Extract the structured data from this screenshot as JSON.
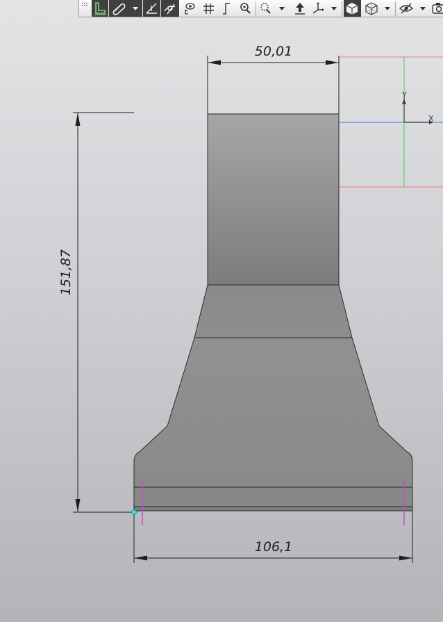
{
  "toolbar": {
    "buttons": [
      {
        "name": "grip-handle",
        "icon": "grip-icon"
      },
      {
        "name": "l-shape-part-button",
        "icon": "l-shape-part-icon",
        "active": true
      },
      {
        "name": "attach-button",
        "icon": "paperclip-icon",
        "active": true
      },
      {
        "name": "attach-dropdown",
        "icon": "chevron-down-icon",
        "active": true
      },
      {
        "name": "slope-button",
        "icon": "slope-icon",
        "active": true
      },
      {
        "name": "view-filter-button",
        "icon": "eye-filter-icon",
        "active": true
      },
      {
        "name": "point-visibility-button",
        "icon": "eye-point-icon"
      },
      {
        "name": "grid-button",
        "icon": "grid-icon"
      },
      {
        "name": "ortho-button",
        "icon": "ortho-step-icon"
      },
      {
        "name": "zoom-in-button",
        "icon": "magnifier-icon"
      },
      {
        "name": "zoom-window-button",
        "icon": "zoom-window-icon"
      },
      {
        "name": "zoom-dropdown",
        "icon": "chevron-down-icon"
      },
      {
        "name": "move-view-button",
        "icon": "move-arrow-icon"
      },
      {
        "name": "orientation-button",
        "icon": "axes-icon"
      },
      {
        "name": "orientation-dropdown",
        "icon": "chevron-down-icon"
      },
      {
        "name": "shaded-button",
        "icon": "shaded-cube-icon",
        "active": true
      },
      {
        "name": "wireframe-button",
        "icon": "wireframe-cube-icon"
      },
      {
        "name": "display-mode-dropdown",
        "icon": "chevron-down-icon"
      },
      {
        "name": "hide-button",
        "icon": "eye-hide-icon"
      },
      {
        "name": "hide-dropdown",
        "icon": "chevron-down-icon"
      },
      {
        "name": "camera-button",
        "icon": "camera-icon"
      }
    ]
  },
  "drawing": {
    "dim_top": "50,01",
    "dim_height": "151,87",
    "dim_bottom": "106,1",
    "axis_y_label": "Y",
    "axis_x_label": "X"
  },
  "colors": {
    "dimension_line": "#1e1e1e",
    "part_outline": "#2a2a2a",
    "axis_x": "#5a8ce0",
    "axis_y": "#59d45a",
    "frame": "#f08080",
    "constraint": "#cc44cc",
    "selected_point": "#29e0f0"
  }
}
